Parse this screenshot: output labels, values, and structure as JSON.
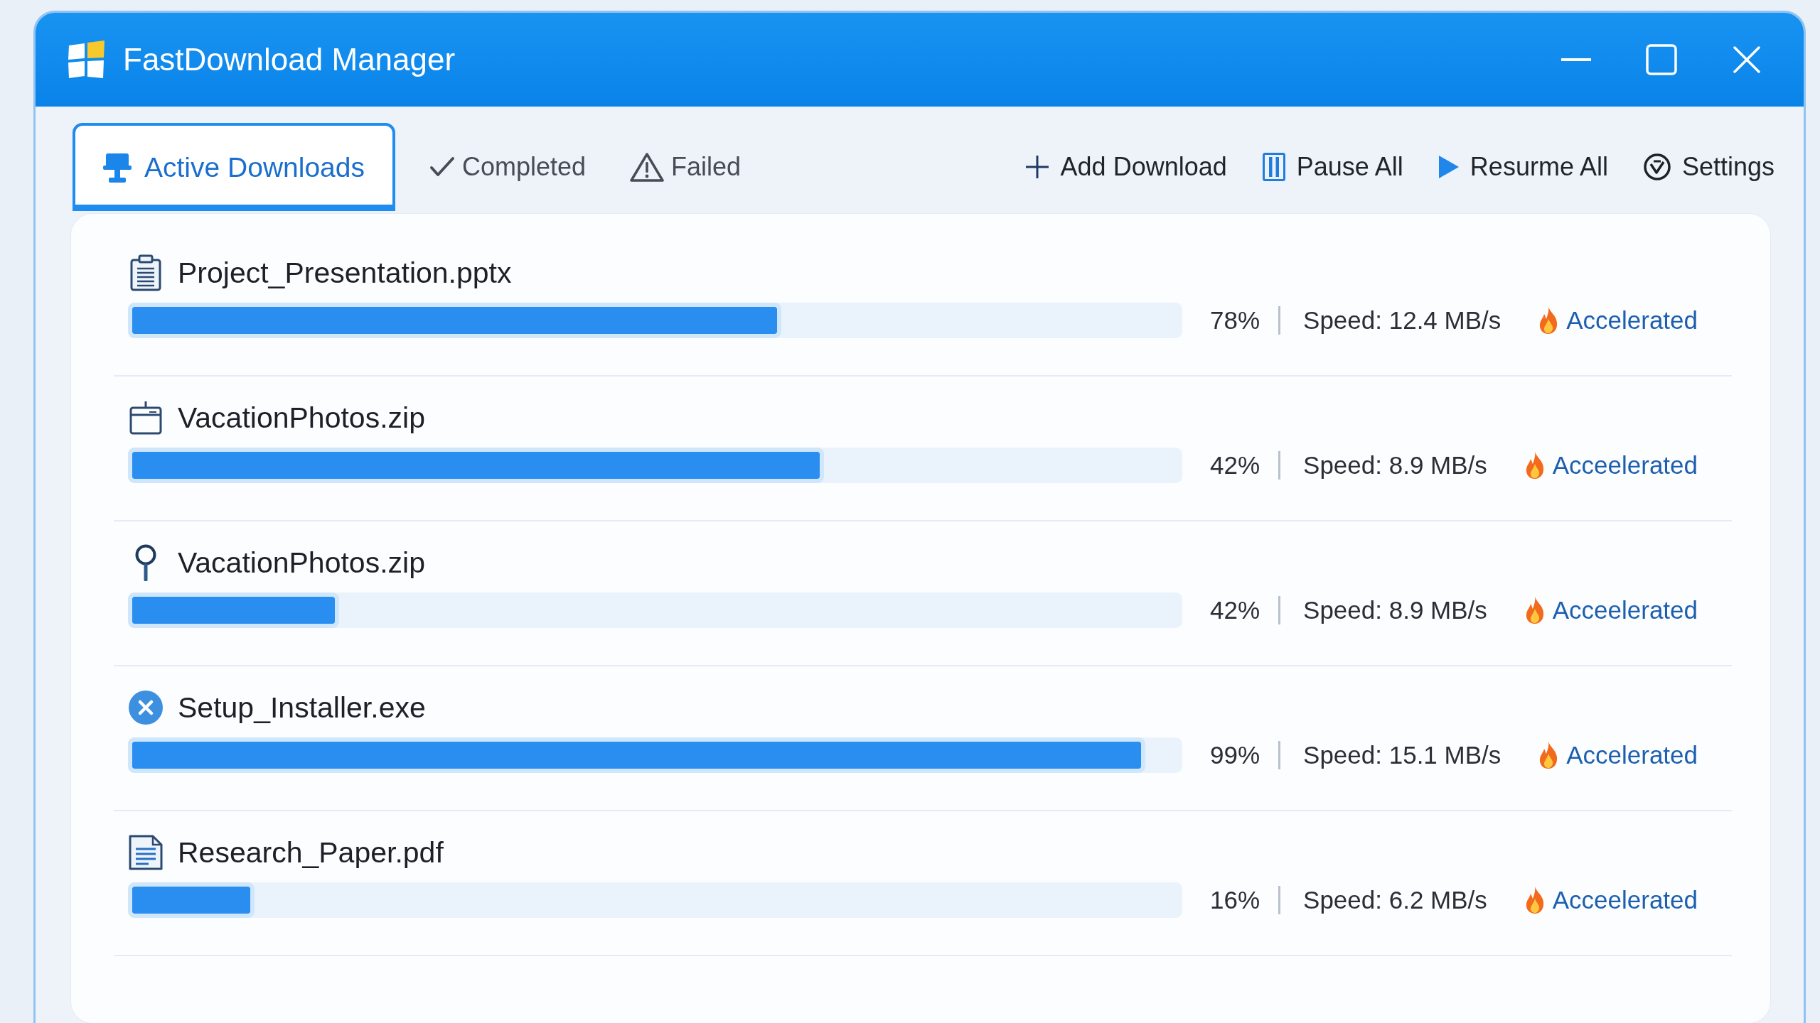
{
  "window": {
    "title": "FastDownload Manager"
  },
  "tabs": [
    {
      "kind": "monitor",
      "label": "Active Downloads",
      "selected": true
    },
    {
      "kind": "check",
      "label": "Completed",
      "selected": false
    },
    {
      "kind": "warning",
      "label": "Failed",
      "selected": false
    }
  ],
  "toolbar": [
    {
      "kind": "plus",
      "label": "Add Download"
    },
    {
      "kind": "pause",
      "label": "Pause All"
    },
    {
      "kind": "play",
      "label": "Resurme All"
    },
    {
      "kind": "settings",
      "label": "Settings"
    }
  ],
  "downloads": [
    {
      "kind": "clipboard",
      "name": "Project_Presentation.pptx",
      "level": 0.62,
      "percent": "78%",
      "speed": "Speed: 12.4 MB/s",
      "status": "Accelerated"
    },
    {
      "kind": "calendar",
      "name": "VacationPhotos.zip",
      "level": 0.66,
      "percent": "42%",
      "speed": "Speed: 8.9 MB/s",
      "status": "Acceelerated"
    },
    {
      "kind": "pin",
      "name": "VacationPhotos.zip",
      "level": 0.2,
      "percent": "42%",
      "speed": "Speed: 8.9 MB/s",
      "status": "Acceelerated"
    },
    {
      "kind": "error",
      "name": "Setup_Installer.exe",
      "level": 0.965,
      "percent": "99%",
      "speed": "Speed: 15.1 MB/s",
      "status": "Accelerated"
    },
    {
      "kind": "document",
      "name": "Research_Paper.pdf",
      "level": 0.12,
      "percent": "16%",
      "speed": "Speed: 6.2 MB/s",
      "status": "Acceelerated"
    }
  ]
}
